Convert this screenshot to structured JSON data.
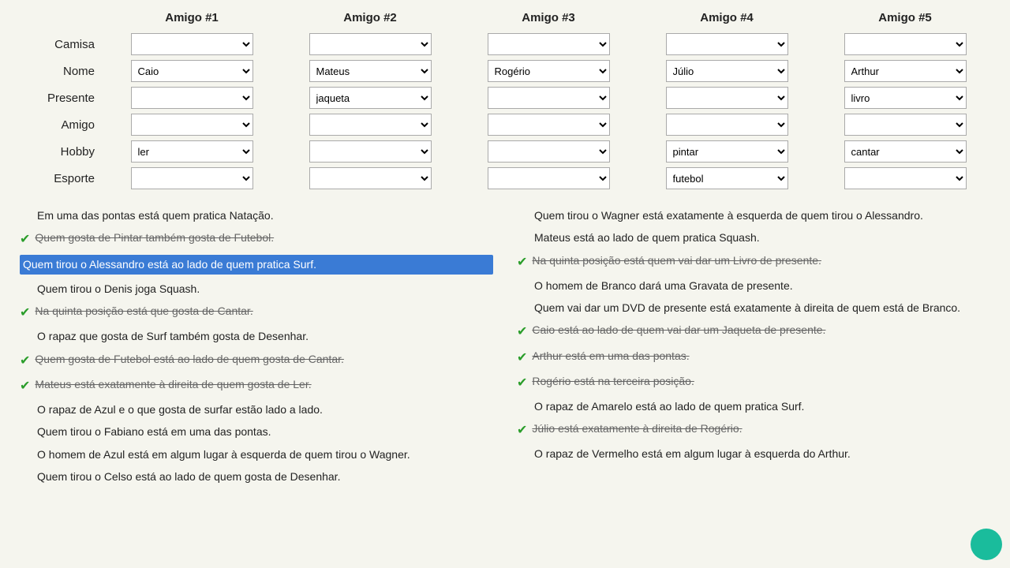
{
  "headers": {
    "col1": "Amigo #1",
    "col2": "Amigo #2",
    "col3": "Amigo #3",
    "col4": "Amigo #4",
    "col5": "Amigo #5"
  },
  "rows": [
    {
      "label": "Camisa",
      "values": [
        "",
        "",
        "",
        "",
        ""
      ]
    },
    {
      "label": "Nome",
      "values": [
        "Caio",
        "Mateus",
        "Rogério",
        "Júlio",
        "Arthur"
      ]
    },
    {
      "label": "Presente",
      "values": [
        "",
        "jaqueta",
        "",
        "",
        "livro"
      ]
    },
    {
      "label": "Amigo",
      "values": [
        "",
        "",
        "",
        "",
        ""
      ]
    },
    {
      "label": "Hobby",
      "values": [
        "ler",
        "",
        "",
        "pintar",
        "cantar"
      ]
    },
    {
      "label": "Esporte",
      "values": [
        "",
        "",
        "",
        "futebol",
        ""
      ]
    }
  ],
  "clues_left": [
    {
      "id": "cl1",
      "text": "Em uma das pontas está quem pratica Natação.",
      "state": "normal",
      "has_check": false
    },
    {
      "id": "cl2",
      "text": "Quem gosta de Pintar também gosta de Futebol.",
      "state": "strikethrough",
      "has_check": true
    },
    {
      "id": "cl3",
      "text": "Quem tirou o Alessandro está ao lado de quem pratica Surf.",
      "state": "highlighted",
      "has_check": false
    },
    {
      "id": "cl4",
      "text": "Quem tirou o Denis joga Squash.",
      "state": "normal",
      "has_check": false
    },
    {
      "id": "cl5",
      "text": "Na quinta posição está que gosta de Cantar.",
      "state": "strikethrough",
      "has_check": true
    },
    {
      "id": "cl6",
      "text": "O rapaz que gosta de Surf também gosta de Desenhar.",
      "state": "normal",
      "has_check": false
    },
    {
      "id": "cl7",
      "text": "Quem gosta de Futebol está ao lado de quem gosta de Cantar.",
      "state": "strikethrough",
      "has_check": true
    },
    {
      "id": "cl8",
      "text": "Mateus está exatamente à direita de quem gosta de Ler.",
      "state": "strikethrough",
      "has_check": true
    },
    {
      "id": "cl9",
      "text": "O rapaz de Azul e o que gosta de surfar estão lado a lado.",
      "state": "normal",
      "has_check": false
    },
    {
      "id": "cl10",
      "text": "Quem tirou o Fabiano está em uma das pontas.",
      "state": "normal",
      "has_check": false
    },
    {
      "id": "cl11",
      "text": "O homem de Azul está em algum lugar à esquerda de quem tirou o Wagner.",
      "state": "normal",
      "has_check": false
    },
    {
      "id": "cl12",
      "text": "Quem tirou o Celso está ao lado de quem gosta de Desenhar.",
      "state": "normal",
      "has_check": false
    }
  ],
  "clues_right": [
    {
      "id": "cr1",
      "text": "Quem tirou o Wagner está exatamente à esquerda de quem tirou o Alessandro.",
      "state": "normal",
      "has_check": false
    },
    {
      "id": "cr2",
      "text": "Mateus está ao lado de quem pratica Squash.",
      "state": "normal",
      "has_check": false
    },
    {
      "id": "cr3",
      "text": "Na quinta posição está quem vai dar um Livro de presente.",
      "state": "strikethrough",
      "has_check": true
    },
    {
      "id": "cr4",
      "text": "O homem de Branco dará uma Gravata de presente.",
      "state": "normal",
      "has_check": false
    },
    {
      "id": "cr5",
      "text": "Quem vai dar um DVD de presente está exatamente à direita de quem está de Branco.",
      "state": "normal",
      "has_check": false
    },
    {
      "id": "cr6",
      "text": "Caio está ao lado de quem vai dar um Jaqueta de presente.",
      "state": "strikethrough",
      "has_check": true
    },
    {
      "id": "cr7",
      "text": "Arthur está em uma das pontas.",
      "state": "strikethrough",
      "has_check": true
    },
    {
      "id": "cr8",
      "text": "Rogério está na terceira posição.",
      "state": "strikethrough",
      "has_check": true
    },
    {
      "id": "cr9",
      "text": "O rapaz de Amarelo está ao lado de quem pratica Surf.",
      "state": "normal",
      "has_check": false
    },
    {
      "id": "cr10",
      "text": "Júlio está exatamente à direita de Rogério.",
      "state": "strikethrough",
      "has_check": true
    },
    {
      "id": "cr11",
      "text": "O rapaz de Vermelho está em algum lugar à esquerda do Arthur.",
      "state": "normal",
      "has_check": false
    }
  ],
  "select_options": {
    "nome": [
      "",
      "Caio",
      "Mateus",
      "Rogério",
      "Júlio",
      "Arthur"
    ],
    "presente": [
      "",
      "jaqueta",
      "livro",
      "DVD",
      "gravata"
    ],
    "hobby": [
      "",
      "ler",
      "pintar",
      "cantar",
      "surf",
      "desenhar"
    ],
    "esporte": [
      "",
      "futebol",
      "squash",
      "natação"
    ],
    "camisa": [
      "",
      "azul",
      "branco",
      "amarelo",
      "vermelho"
    ],
    "amigo": [
      "",
      "Alessandro",
      "Wagner",
      "Denis",
      "Fabiano",
      "Celso"
    ]
  }
}
